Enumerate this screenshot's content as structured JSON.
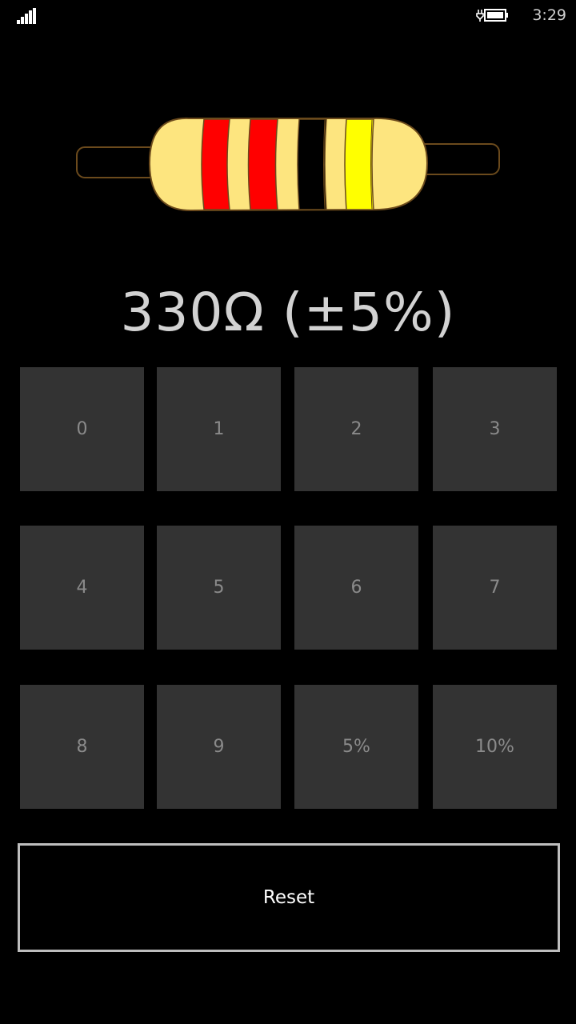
{
  "status_bar": {
    "time": "3:29",
    "signal_icon": "signal-bars-icon",
    "battery_icon": "battery-charging-icon"
  },
  "resistor": {
    "body_color": "#fde57f",
    "band_colors": [
      "#ff0000",
      "#ff0000",
      "#000000",
      "#ffff00"
    ],
    "band_names": [
      "red",
      "red",
      "black",
      "yellow"
    ]
  },
  "value_display": "330Ω (±5%)",
  "keypad": {
    "buttons": [
      "0",
      "1",
      "2",
      "3",
      "4",
      "5",
      "6",
      "7",
      "8",
      "9",
      "5%",
      "10%"
    ]
  },
  "reset_label": "Reset",
  "colors": {
    "background": "#000000",
    "button_bg": "#333333",
    "button_text": "#8a8a8a",
    "display_text": "#d2d2d2",
    "reset_border": "#bdbdbd"
  }
}
